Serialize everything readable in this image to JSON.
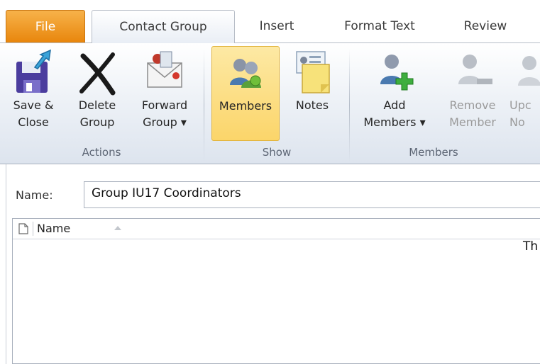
{
  "tabs": {
    "file": "File",
    "contact_group": "Contact Group",
    "insert": "Insert",
    "format_text": "Format Text",
    "review": "Review"
  },
  "groups": {
    "actions": {
      "label": "Actions",
      "save_close": [
        "Save &",
        "Close"
      ],
      "delete_group": [
        "Delete",
        "Group"
      ],
      "forward_group": [
        "Forward",
        "Group ▾"
      ]
    },
    "show": {
      "label": "Show",
      "members": "Members",
      "notes": "Notes"
    },
    "members": {
      "label": "Members",
      "add_members": [
        "Add",
        "Members ▾"
      ],
      "remove_member": [
        "Remove",
        "Member"
      ],
      "update_now": [
        "Upc",
        "No"
      ]
    }
  },
  "form": {
    "name_label": "Name:",
    "name_value": "Group IU17 Coordinators"
  },
  "list": {
    "column_name": "Name",
    "partial_text": "Th"
  },
  "colors": {
    "file_tab": "#e8860c",
    "pressed": "#fbd56a"
  }
}
